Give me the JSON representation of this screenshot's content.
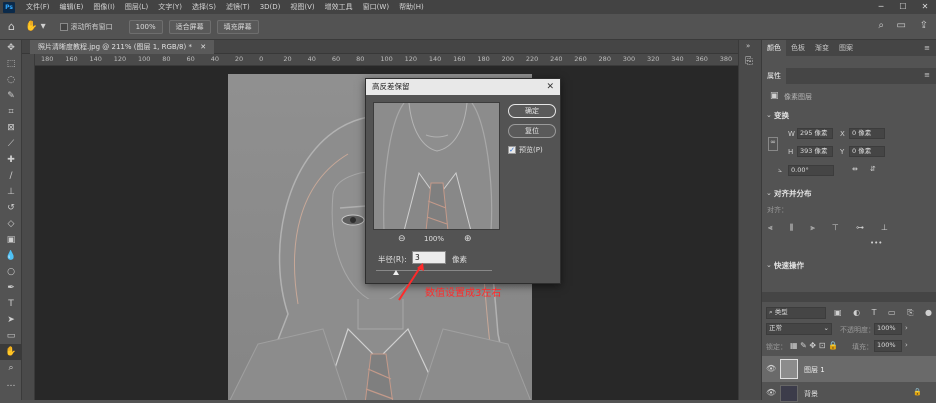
{
  "menubar": {
    "logo": "Ps",
    "items": [
      "文件(F)",
      "编辑(E)",
      "图像(I)",
      "图层(L)",
      "文字(Y)",
      "选择(S)",
      "滤镜(T)",
      "3D(D)",
      "视图(V)",
      "增效工具",
      "窗口(W)",
      "帮助(H)"
    ]
  },
  "options": {
    "scroll_all": "滚动所有窗口",
    "zoom": "100%",
    "fit_screen": "适合屏幕",
    "fill_screen": "填充屏幕"
  },
  "document": {
    "tab_title": "照片清晰度教程.jpg @ 211% (图层 1, RGB/8) *",
    "ruler_ticks": [
      "180",
      "160",
      "140",
      "120",
      "100",
      "80",
      "60",
      "40",
      "20",
      "0",
      "20",
      "40",
      "60",
      "80",
      "100",
      "120",
      "140",
      "160",
      "180",
      "200",
      "220",
      "240",
      "260",
      "280",
      "300",
      "320",
      "340",
      "360",
      "380"
    ]
  },
  "dialog": {
    "title": "高反差保留",
    "ok": "确定",
    "reset": "复位",
    "preview_label": "预览(P)",
    "preview_checked": true,
    "zoom": "100%",
    "radius_label": "半径(R):",
    "radius_value": "3",
    "unit": "像素",
    "slider_level": 0.17
  },
  "annotation": {
    "text": "数值设置成3左右",
    "color": "#ff2a2a"
  },
  "panel": {
    "tabs": [
      "颜色",
      "色板",
      "渐变",
      "图案"
    ],
    "properties_tab": "属性",
    "pixel_layer": "像素图层",
    "transform_title": "变换",
    "w_label": "W",
    "w_value": "295 像素",
    "h_label": "H",
    "h_value": "393 像素",
    "x_label": "X",
    "x_value": "0 像素",
    "y_label": "Y",
    "y_value": "0 像素",
    "angle_value": "0.00°",
    "align_title": "对齐并分布",
    "align_sub": "对齐：",
    "quick_title": "快速操作",
    "layers": {
      "filter_kind": "类型",
      "blend_mode": "正常",
      "opacity_label": "不透明度：",
      "opacity_value": "100%",
      "lock_label": "锁定：",
      "fill_label": "填充：",
      "fill_value": "100%",
      "items": [
        {
          "name": "图层 1"
        },
        {
          "name": "背景"
        }
      ]
    }
  }
}
